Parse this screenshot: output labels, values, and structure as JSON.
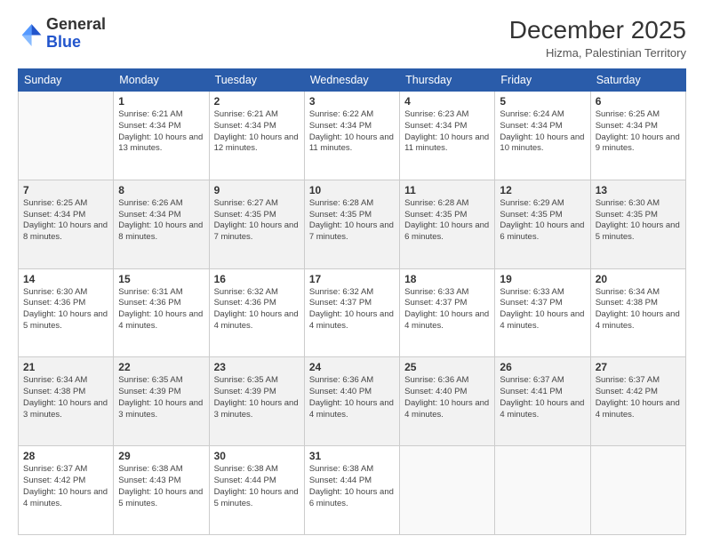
{
  "header": {
    "logo_general": "General",
    "logo_blue": "Blue",
    "month_year": "December 2025",
    "location": "Hizma, Palestinian Territory"
  },
  "days_of_week": [
    "Sunday",
    "Monday",
    "Tuesday",
    "Wednesday",
    "Thursday",
    "Friday",
    "Saturday"
  ],
  "weeks": [
    [
      {
        "day": "",
        "info": ""
      },
      {
        "day": "1",
        "info": "Sunrise: 6:21 AM\nSunset: 4:34 PM\nDaylight: 10 hours\nand 13 minutes."
      },
      {
        "day": "2",
        "info": "Sunrise: 6:21 AM\nSunset: 4:34 PM\nDaylight: 10 hours\nand 12 minutes."
      },
      {
        "day": "3",
        "info": "Sunrise: 6:22 AM\nSunset: 4:34 PM\nDaylight: 10 hours\nand 11 minutes."
      },
      {
        "day": "4",
        "info": "Sunrise: 6:23 AM\nSunset: 4:34 PM\nDaylight: 10 hours\nand 11 minutes."
      },
      {
        "day": "5",
        "info": "Sunrise: 6:24 AM\nSunset: 4:34 PM\nDaylight: 10 hours\nand 10 minutes."
      },
      {
        "day": "6",
        "info": "Sunrise: 6:25 AM\nSunset: 4:34 PM\nDaylight: 10 hours\nand 9 minutes."
      }
    ],
    [
      {
        "day": "7",
        "info": "Sunrise: 6:25 AM\nSunset: 4:34 PM\nDaylight: 10 hours\nand 8 minutes."
      },
      {
        "day": "8",
        "info": "Sunrise: 6:26 AM\nSunset: 4:34 PM\nDaylight: 10 hours\nand 8 minutes."
      },
      {
        "day": "9",
        "info": "Sunrise: 6:27 AM\nSunset: 4:35 PM\nDaylight: 10 hours\nand 7 minutes."
      },
      {
        "day": "10",
        "info": "Sunrise: 6:28 AM\nSunset: 4:35 PM\nDaylight: 10 hours\nand 7 minutes."
      },
      {
        "day": "11",
        "info": "Sunrise: 6:28 AM\nSunset: 4:35 PM\nDaylight: 10 hours\nand 6 minutes."
      },
      {
        "day": "12",
        "info": "Sunrise: 6:29 AM\nSunset: 4:35 PM\nDaylight: 10 hours\nand 6 minutes."
      },
      {
        "day": "13",
        "info": "Sunrise: 6:30 AM\nSunset: 4:35 PM\nDaylight: 10 hours\nand 5 minutes."
      }
    ],
    [
      {
        "day": "14",
        "info": "Sunrise: 6:30 AM\nSunset: 4:36 PM\nDaylight: 10 hours\nand 5 minutes."
      },
      {
        "day": "15",
        "info": "Sunrise: 6:31 AM\nSunset: 4:36 PM\nDaylight: 10 hours\nand 4 minutes."
      },
      {
        "day": "16",
        "info": "Sunrise: 6:32 AM\nSunset: 4:36 PM\nDaylight: 10 hours\nand 4 minutes."
      },
      {
        "day": "17",
        "info": "Sunrise: 6:32 AM\nSunset: 4:37 PM\nDaylight: 10 hours\nand 4 minutes."
      },
      {
        "day": "18",
        "info": "Sunrise: 6:33 AM\nSunset: 4:37 PM\nDaylight: 10 hours\nand 4 minutes."
      },
      {
        "day": "19",
        "info": "Sunrise: 6:33 AM\nSunset: 4:37 PM\nDaylight: 10 hours\nand 4 minutes."
      },
      {
        "day": "20",
        "info": "Sunrise: 6:34 AM\nSunset: 4:38 PM\nDaylight: 10 hours\nand 4 minutes."
      }
    ],
    [
      {
        "day": "21",
        "info": "Sunrise: 6:34 AM\nSunset: 4:38 PM\nDaylight: 10 hours\nand 3 minutes."
      },
      {
        "day": "22",
        "info": "Sunrise: 6:35 AM\nSunset: 4:39 PM\nDaylight: 10 hours\nand 3 minutes."
      },
      {
        "day": "23",
        "info": "Sunrise: 6:35 AM\nSunset: 4:39 PM\nDaylight: 10 hours\nand 3 minutes."
      },
      {
        "day": "24",
        "info": "Sunrise: 6:36 AM\nSunset: 4:40 PM\nDaylight: 10 hours\nand 4 minutes."
      },
      {
        "day": "25",
        "info": "Sunrise: 6:36 AM\nSunset: 4:40 PM\nDaylight: 10 hours\nand 4 minutes."
      },
      {
        "day": "26",
        "info": "Sunrise: 6:37 AM\nSunset: 4:41 PM\nDaylight: 10 hours\nand 4 minutes."
      },
      {
        "day": "27",
        "info": "Sunrise: 6:37 AM\nSunset: 4:42 PM\nDaylight: 10 hours\nand 4 minutes."
      }
    ],
    [
      {
        "day": "28",
        "info": "Sunrise: 6:37 AM\nSunset: 4:42 PM\nDaylight: 10 hours\nand 4 minutes."
      },
      {
        "day": "29",
        "info": "Sunrise: 6:38 AM\nSunset: 4:43 PM\nDaylight: 10 hours\nand 5 minutes."
      },
      {
        "day": "30",
        "info": "Sunrise: 6:38 AM\nSunset: 4:44 PM\nDaylight: 10 hours\nand 5 minutes."
      },
      {
        "day": "31",
        "info": "Sunrise: 6:38 AM\nSunset: 4:44 PM\nDaylight: 10 hours\nand 6 minutes."
      },
      {
        "day": "",
        "info": ""
      },
      {
        "day": "",
        "info": ""
      },
      {
        "day": "",
        "info": ""
      }
    ]
  ]
}
